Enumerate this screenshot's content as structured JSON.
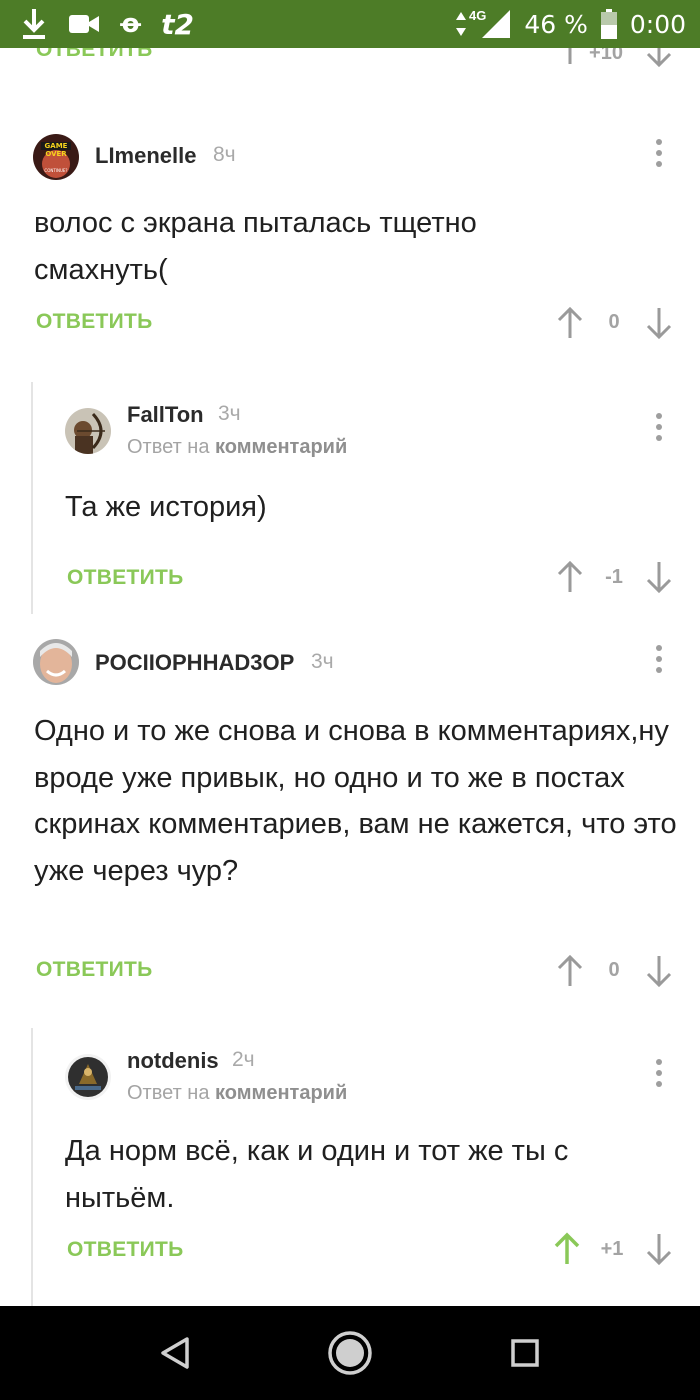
{
  "status_bar": {
    "carrier": "t2",
    "network": "4G",
    "battery": "46 %",
    "time": "0:00"
  },
  "top_partial": {
    "reply_label": "ОТВЕТИТЬ",
    "score": "+10"
  },
  "comments": [
    {
      "author": "LImenelle",
      "time": "8ч",
      "avatar_text_1": "GAME",
      "avatar_text_2": "OVER",
      "avatar_text_3": "CONTINUE?",
      "text": "волос с экрана пыталась тщетно смахнуть(",
      "reply_label": "ОТВЕТИТЬ",
      "score": "0"
    },
    {
      "author": "FallTon",
      "time": "3ч",
      "reply_to_prefix": "Ответ на",
      "reply_to_link": "комментарий",
      "text": "Та же история)",
      "reply_label": "ОТВЕТИТЬ",
      "score": "-1"
    },
    {
      "author": "POCIIOPHHAD3OP",
      "time": "3ч",
      "text": "Одно и то же снова и снова в комментариях,ну вроде уже привык, но одно и то же в постах скринах комментариев, вам не кажется, что это уже через чур?",
      "reply_label": "ОТВЕТИТЬ",
      "score": "0"
    },
    {
      "author": "notdenis",
      "time": "2ч",
      "reply_to_prefix": "Ответ на",
      "reply_to_link": "комментарий",
      "text": "Да норм всё, как и один и тот же ты с нытьём.",
      "reply_label": "ОТВЕТИТЬ",
      "score": "+1"
    }
  ],
  "colors": {
    "status_bar": "#4d7c27",
    "reply_green": "#8ac858",
    "upvoted_green": "#8ac858",
    "muted": "#a3a3a3"
  },
  "icons": [
    "download-icon",
    "video-camera-icon",
    "odnoklassniki-icon",
    "signal-icon",
    "battery-icon",
    "more-vert-icon",
    "arrow-up-icon",
    "arrow-down-icon",
    "back-triangle-icon",
    "home-circle-icon",
    "recents-square-icon"
  ]
}
